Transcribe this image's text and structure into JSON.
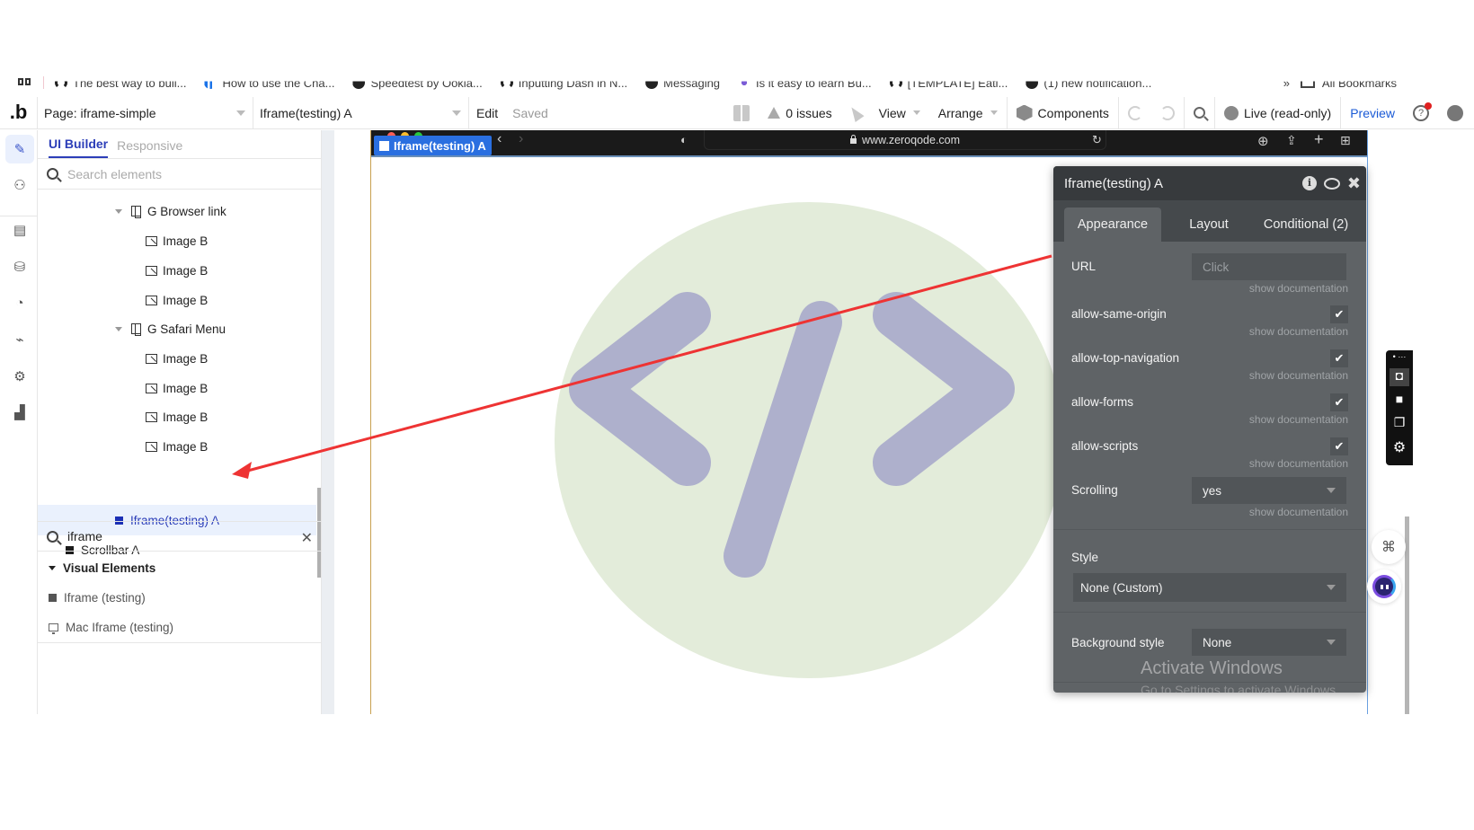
{
  "bookmarks": {
    "items": [
      {
        "label": "The best way to buil...",
        "icon": "bubble-icon"
      },
      {
        "label": "How to use the Cha...",
        "icon": "chart-icon"
      },
      {
        "label": "Speedtest by Ookla...",
        "icon": "speedtest-icon"
      },
      {
        "label": "Inputting Dash in N...",
        "icon": "bubble-icon"
      },
      {
        "label": "Messaging",
        "icon": "messaging-icon"
      },
      {
        "label": "Is it easy to learn Bu...",
        "icon": "dots-icon"
      },
      {
        "label": "[TEMPLATE] Eati...",
        "icon": "bubble-icon"
      },
      {
        "label": "(1) new notification...",
        "icon": "messaging-icon"
      }
    ],
    "more": "»",
    "all_bookmarks": "All Bookmarks"
  },
  "appbar": {
    "logo": ".b",
    "page_selector": "Page: iframe-simple",
    "element_selector": "Iframe(testing) A",
    "edit": "Edit",
    "saved": "Saved",
    "issues": "0 issues",
    "view": "View",
    "arrange": "Arrange",
    "components": "Components",
    "live": "Live (read-only)",
    "preview": "Preview"
  },
  "rail": {
    "items": [
      "design",
      "element-tree",
      "workflow",
      "data",
      "styles",
      "plugins",
      "settings",
      "logs"
    ]
  },
  "panel": {
    "tabs": [
      {
        "label": "UI Builder",
        "active": true
      },
      {
        "label": "Responsive",
        "active": false
      }
    ],
    "search_placeholder": "Search elements",
    "tree": [
      {
        "label": "G Browser link",
        "type": "group",
        "expanded": true,
        "depth": 2
      },
      {
        "label": "Image B",
        "type": "image",
        "depth": 3
      },
      {
        "label": "Image B",
        "type": "image",
        "depth": 3
      },
      {
        "label": "Image B",
        "type": "image",
        "depth": 3
      },
      {
        "label": "G Safari Menu",
        "type": "group",
        "expanded": true,
        "depth": 2
      },
      {
        "label": "Image B",
        "type": "image",
        "depth": 3
      },
      {
        "label": "Image B",
        "type": "image",
        "depth": 3
      },
      {
        "label": "Image B",
        "type": "image",
        "depth": 3
      },
      {
        "label": "Image B",
        "type": "image",
        "depth": 3
      },
      {
        "label": "Iframe(testing) A",
        "type": "element",
        "depth": 2,
        "selected": true
      },
      {
        "label": "Scrollbar A",
        "type": "element",
        "depth": 1
      }
    ],
    "palette_search": "iframe",
    "palette_section": "Visual Elements",
    "palette_items": [
      {
        "label": "Iframe (testing)",
        "icon": "square-icon"
      },
      {
        "label": "Mac Iframe (testing)",
        "icon": "monitor-icon"
      }
    ]
  },
  "canvas": {
    "element_tag": "Iframe(testing) A",
    "url": "www.zeroqode.com",
    "colors": {
      "circle": "#e3ecda",
      "code": "#aeb0cc",
      "arrow": "#ee3333"
    }
  },
  "props": {
    "title": "Iframe(testing) A",
    "tabs": [
      {
        "label": "Appearance",
        "active": true
      },
      {
        "label": "Layout",
        "active": false
      },
      {
        "label": "Conditional (2)",
        "active": false
      }
    ],
    "url_label": "URL",
    "url_placeholder": "Click",
    "doc_link": "show documentation",
    "checkboxes": [
      {
        "label": "allow-same-origin",
        "checked": true
      },
      {
        "label": "allow-top-navigation",
        "checked": true
      },
      {
        "label": "allow-forms",
        "checked": true
      },
      {
        "label": "allow-scripts",
        "checked": true
      }
    ],
    "scrolling_label": "Scrolling",
    "scrolling_value": "yes",
    "style_label": "Style",
    "style_value": "None (Custom)",
    "bg_label": "Background style",
    "bg_value": "None"
  },
  "watermark": {
    "title": "Activate Windows",
    "subtitle": "Go to Settings to activate Windows."
  }
}
